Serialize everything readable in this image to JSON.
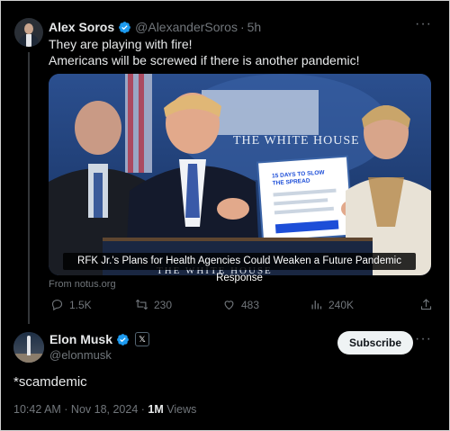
{
  "quoted_tweet": {
    "author_name": "Alex Soros",
    "handle": "@AlexanderSoros",
    "time": "5h",
    "text_line1": "They are playing with fire!",
    "text_line2": "Americans will be screwed if there is another pandemic!",
    "media_caption": "RFK Jr.'s Plans for Health Agencies Could Weaken a Future Pandemic Response",
    "source": "From notus.org",
    "image_text": {
      "podium_sign": "THE WHITE HOUSE",
      "backdrop": "THE WHITE HOUSE",
      "document_title_line1": "15 DAYS TO SLOW",
      "document_title_line2": "THE SPREAD"
    },
    "actions": {
      "replies": "1.5K",
      "reposts": "230",
      "likes": "483",
      "views": "240K"
    }
  },
  "main_tweet": {
    "author_name": "Elon Musk",
    "handle": "@elonmusk",
    "subscribe_label": "Subscribe",
    "text": "*scamdemic",
    "timestamp": "10:42 AM · Nov 18, 2024 ·",
    "views_count": "1M",
    "views_label": "Views"
  },
  "icons": [
    "reply-icon",
    "repost-icon",
    "like-icon",
    "views-icon",
    "share-icon",
    "verified-icon",
    "more-icon",
    "x-badge-icon"
  ],
  "colors": {
    "verified": "#1d9bf0",
    "muted": "#71767b",
    "text": "#e7e9ea",
    "background": "#000000"
  }
}
